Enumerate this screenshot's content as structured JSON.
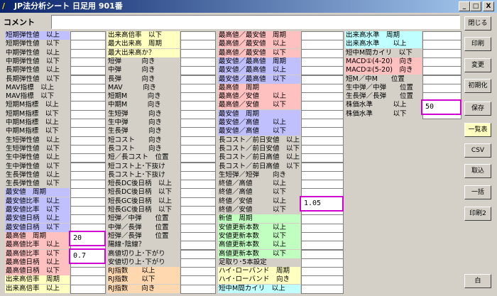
{
  "window": {
    "title": "JP法分析シート 日足用 901番",
    "controls": [
      "_",
      "□",
      "X"
    ]
  },
  "comment": {
    "label": "コメント",
    "value": ""
  },
  "buttons": {
    "close": "閉じる",
    "print": "印刷",
    "change": "変更",
    "init": "初期化",
    "save": "保存",
    "list": "一覧表",
    "csv": "CSV",
    "import": "取込",
    "batch": "一括",
    "print2": "印刷2",
    "white": "白"
  },
  "columns": [
    {
      "rows": [
        {
          "label": "短期弾性値　以上",
          "color": "#c0c0ff"
        },
        {
          "label": "短期弾性値　以下",
          "color": "#d4d0c8"
        },
        {
          "label": "中期弾性値　以上",
          "color": "#d4d0c8"
        },
        {
          "label": "中期弾性値　以下",
          "color": "#d4d0c8"
        },
        {
          "label": "長期弾性値　以上",
          "color": "#d4d0c8"
        },
        {
          "label": "長期弾性値　以下",
          "color": "#d4d0c8"
        },
        {
          "label": "MAV指標　以上",
          "color": "#d4d0c8"
        },
        {
          "label": "MAV指標　以下",
          "color": "#d4d0c8"
        },
        {
          "label": "短期M指標　以上",
          "color": "#d4d0c8"
        },
        {
          "label": "短期M指標　以下",
          "color": "#d4d0c8"
        },
        {
          "label": "中期M指標　以上",
          "color": "#d4d0c8"
        },
        {
          "label": "中期M指標　以下",
          "color": "#d4d0c8"
        },
        {
          "label": "生短弾性値　以上",
          "color": "#d4d0c8"
        },
        {
          "label": "生短弾性値　以下",
          "color": "#d4d0c8"
        },
        {
          "label": "生中弾性値　以上",
          "color": "#d4d0c8"
        },
        {
          "label": "生中弾性値　以下",
          "color": "#d4d0c8"
        },
        {
          "label": "生長弾性値　以上",
          "color": "#d4d0c8"
        },
        {
          "label": "生長弾性値　以下",
          "color": "#d4d0c8"
        },
        {
          "label": "最安値　周期",
          "color": "#c0c0ff"
        },
        {
          "label": "最安値比率　以上",
          "color": "#c0c0ff"
        },
        {
          "label": "最安値比率　以下",
          "color": "#c0c0ff"
        },
        {
          "label": "最安値日柄　以上",
          "color": "#c0c0ff"
        },
        {
          "label": "最安値日柄　以下",
          "color": "#c0c0ff"
        },
        {
          "label": "最高値　周期",
          "color": "#ffc0c0"
        },
        {
          "label": "最高値比率　以上",
          "color": "#ffc0c0"
        },
        {
          "label": "最高値比率　以下",
          "color": "#ffc0c0"
        },
        {
          "label": "最高値日柄　以上",
          "color": "#ffc0c0"
        },
        {
          "label": "最高値日柄　以下",
          "color": "#ffc0c0"
        },
        {
          "label": "出来高倍率　周期",
          "color": "#ffffc0"
        },
        {
          "label": "出来高倍率　以上",
          "color": "#ffffc0"
        }
      ],
      "values": {
        "23": "20",
        "25": "0.7"
      }
    },
    {
      "rows": [
        {
          "label": "出来高倍率　以下",
          "color": "#ffffc0"
        },
        {
          "label": "最大出来高　周期",
          "color": "#ffffc0"
        },
        {
          "label": "最大出来高か？",
          "color": "#ffffc0"
        },
        {
          "label": "短弾　　　向き",
          "color": "#d4d0c8"
        },
        {
          "label": "中弾　　　向き",
          "color": "#d4d0c8"
        },
        {
          "label": "長弾　　　向き",
          "color": "#d4d0c8"
        },
        {
          "label": "MAV　　　向き",
          "color": "#d4d0c8"
        },
        {
          "label": "短期M　　　向き",
          "color": "#d4d0c8"
        },
        {
          "label": "中期M　　　向き",
          "color": "#d4d0c8"
        },
        {
          "label": "生短弾　　　向き",
          "color": "#d4d0c8"
        },
        {
          "label": "生中弾　　　向き",
          "color": "#d4d0c8"
        },
        {
          "label": "生長弾　　　向き",
          "color": "#d4d0c8"
        },
        {
          "label": "短コスト　　向き",
          "color": "#d4d0c8"
        },
        {
          "label": "長コスト　　向き",
          "color": "#d4d0c8"
        },
        {
          "label": "短／長コスト　位置",
          "color": "#d4d0c8"
        },
        {
          "label": "短コスト上･下抜け",
          "color": "#d4d0c8"
        },
        {
          "label": "長コスト上･下抜け",
          "color": "#d4d0c8"
        },
        {
          "label": "短長DC後日柄　以上",
          "color": "#d4d0c8"
        },
        {
          "label": "短長DC後日柄　以下",
          "color": "#d4d0c8"
        },
        {
          "label": "短長GC後日柄　以上",
          "color": "#d4d0c8"
        },
        {
          "label": "短長GC後日柄　以下",
          "color": "#d4d0c8"
        },
        {
          "label": "短弾／中弾　　位置",
          "color": "#d4d0c8"
        },
        {
          "label": "中弾／長弾　　位置",
          "color": "#d4d0c8"
        },
        {
          "label": "短弾／長弾　　位置",
          "color": "#d4d0c8"
        },
        {
          "label": "陽線･陰線？",
          "color": "#d4d0c8"
        },
        {
          "label": "高値切り上･下がり",
          "color": "#d4d0c8"
        },
        {
          "label": "安値切り上･下がり",
          "color": "#d4d0c8"
        },
        {
          "label": "RJ指数　　以上",
          "color": "#ffd8b0"
        },
        {
          "label": "RJ指数　　以下",
          "color": "#ffd8b0"
        },
        {
          "label": "RJ指数　　向き",
          "color": "#ffd8b0"
        }
      ],
      "values": {}
    },
    {
      "rows": [
        {
          "label": "最高値／最安値　周期",
          "color": "#ffc0c0"
        },
        {
          "label": "最高値／最安値　以上",
          "color": "#ffc0c0"
        },
        {
          "label": "最高値／最安値　以下",
          "color": "#ffc0c0"
        },
        {
          "label": "最安値／最高値　周期",
          "color": "#c0c0ff"
        },
        {
          "label": "最安値／最高値　以上",
          "color": "#c0c0ff"
        },
        {
          "label": "最安値／最高値　以下",
          "color": "#c0c0ff"
        },
        {
          "label": "最高値　周期",
          "color": "#ffc0c0"
        },
        {
          "label": "最高値／安値　　以上",
          "color": "#ffc0c0"
        },
        {
          "label": "最高値／安値　　以下",
          "color": "#ffc0c0"
        },
        {
          "label": "最安値　周期",
          "color": "#c0c0ff"
        },
        {
          "label": "最安値／高値　　以上",
          "color": "#c0c0ff"
        },
        {
          "label": "最安値／高値　　以下",
          "color": "#c0c0ff"
        },
        {
          "label": "長コスト／前日安値　以上",
          "color": "#d4d0c8"
        },
        {
          "label": "長コスト／前日安値　以下",
          "color": "#d4d0c8"
        },
        {
          "label": "長コスト／前日高値　以上",
          "color": "#d4d0c8"
        },
        {
          "label": "長コスト／前日高値　以下",
          "color": "#d4d0c8"
        },
        {
          "label": "生短弾／短弾　　向き",
          "color": "#d4d0c8"
        },
        {
          "label": "終値／高値　　　以上",
          "color": "#d4d0c8"
        },
        {
          "label": "終値／高値　　　以下",
          "color": "#d4d0c8"
        },
        {
          "label": "終値／安値　　　以上",
          "color": "#d4d0c8"
        },
        {
          "label": "終値／安値　　　以下",
          "color": "#d4d0c8"
        },
        {
          "label": "新値　周期",
          "color": "#c0ffc0"
        },
        {
          "label": "安値更新本数　　以上",
          "color": "#c0ffc0"
        },
        {
          "label": "安値更新本数　　以下",
          "color": "#c0ffc0"
        },
        {
          "label": "高値更新本数　　以上",
          "color": "#c0ffc0"
        },
        {
          "label": "高値更新本数　　以下",
          "color": "#c0ffc0"
        },
        {
          "label": "足取り･5本設定",
          "color": "#d4d0c8"
        },
        {
          "label": "ハイ･ローバンド　周期",
          "color": "#ffffc0"
        },
        {
          "label": "ハイ･ローバンド　向き",
          "color": "#ffffc0"
        },
        {
          "label": "短中M間カイリ　以上",
          "color": "#c0ffff"
        }
      ],
      "values": {
        "19": "1.05"
      }
    },
    {
      "rows": [
        {
          "label": "出来高水準　周期",
          "color": "#c0ffff"
        },
        {
          "label": "出来高水準　　以上",
          "color": "#c0ffff"
        },
        {
          "label": "短中M間カイリ　以下",
          "color": "#d4d0c8"
        },
        {
          "label": "MACD①(4-20)　向き",
          "color": "#ffc0c0"
        },
        {
          "label": "MACD②(5-20)　向き",
          "color": "#ffc0c0"
        },
        {
          "label": "短M／中M　　位置",
          "color": "#d4d0c8"
        },
        {
          "label": "生中弾／中弾　　位置",
          "color": "#d4d0c8"
        },
        {
          "label": "生長弾／長弾　　位置",
          "color": "#d4d0c8"
        },
        {
          "label": "株価水準　　　以上",
          "color": "#d4d0c8"
        },
        {
          "label": "株価水準　　　以下",
          "color": "#d4d0c8"
        }
      ],
      "values": {
        "8": "50"
      }
    }
  ]
}
